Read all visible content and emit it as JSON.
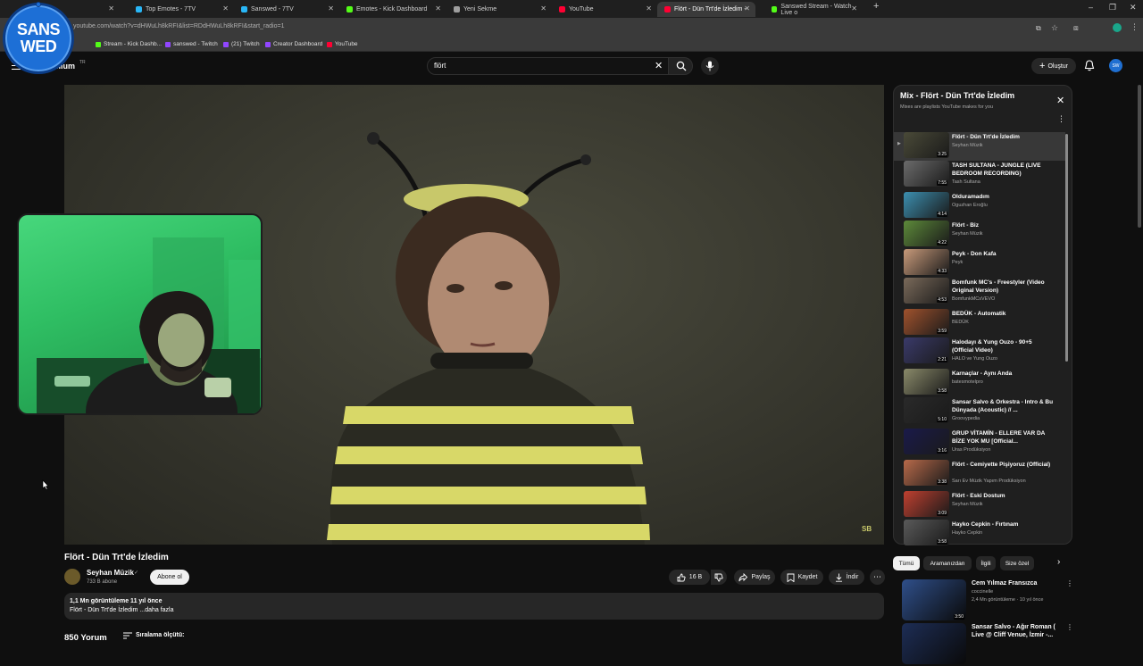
{
  "browser": {
    "tabs": [
      {
        "label": "",
        "favicon_color": "#8a8a8a"
      },
      {
        "label": "Top Emotes - 7TV",
        "favicon_color": "#29b6f6"
      },
      {
        "label": "Sanswed - 7TV",
        "favicon_color": "#29b6f6"
      },
      {
        "label": "Emotes - Kick Dashboard",
        "favicon_color": "#53fc18"
      },
      {
        "label": "Yeni Sekme",
        "favicon_color": "#9e9e9e"
      },
      {
        "label": "YouTube",
        "favicon_color": "#ff0033"
      },
      {
        "label": "Flört - Dün Trt'de İzledim -",
        "favicon_color": "#ff0033"
      },
      {
        "label": "Sanswed Stream - Watch Live o",
        "favicon_color": "#53fc18"
      }
    ],
    "url": "youtube.com/watch?v=dHWuLh8kRFI&list=RDdHWuLh8kRFI&start_radio=1",
    "bookmarks": [
      {
        "label": "Stream - Kick Dashb...",
        "favicon_color": "#53fc18"
      },
      {
        "label": "sanswed - Twitch",
        "favicon_color": "#9146ff"
      },
      {
        "label": "(21) Twitch",
        "favicon_color": "#9146ff"
      },
      {
        "label": "Creator Dashboard",
        "favicon_color": "#9146ff"
      },
      {
        "label": "YouTube",
        "favicon_color": "#ff0033"
      }
    ]
  },
  "overlay": {
    "logo_line1": "SANS",
    "logo_line2": "WED"
  },
  "header": {
    "brand": "mium",
    "brand_region": "TR",
    "search_value": "flört",
    "create_label": "Oluştur",
    "avatar_label": "SW"
  },
  "video": {
    "title": "Flört - Dün Trt'de İzledim",
    "watermark": "SB",
    "channel": {
      "name": "Seyhan Müzik",
      "subscribers": "733 B abone",
      "verified_icon": "✓"
    },
    "subscribe_label": "Abone ol",
    "likes": "16 B",
    "share_label": "Paylaş",
    "save_label": "Kaydet",
    "download_label": "İndir",
    "description": {
      "meta": "1,1 Mn görüntüleme  11 yıl önce",
      "text": "Flört - Dün Trt'de İzledim ...daha fazla"
    },
    "comments": {
      "count": "850 Yorum",
      "sort_label": "Sıralama ölçütü:"
    }
  },
  "playlist": {
    "title": "Mix - Flört - Dün Trt'de İzledim",
    "subtitle": "Mixes are playlists YouTube makes for you",
    "items": [
      {
        "title": "Flört - Dün Trt'de İzledim",
        "channel": "Seyhan Müzik",
        "duration": "3:25",
        "thumb": "#4a4a38"
      },
      {
        "title": "TASH SULTANA - JUNGLE (LIVE BEDROOM RECORDING)",
        "channel": "Tash Sultana",
        "duration": "7:55",
        "thumb": "#6b6b6b"
      },
      {
        "title": "Olduramadım",
        "channel": "Oguzhan Eroğlu",
        "duration": "4:14",
        "thumb": "#3c8fb0"
      },
      {
        "title": "Flört - Biz",
        "channel": "Seyhan Müzik",
        "duration": "4:22",
        "thumb": "#5d8a3a"
      },
      {
        "title": "Peyk - Don Kafa",
        "channel": "Peyk",
        "duration": "4:33",
        "thumb": "#c89a7a"
      },
      {
        "title": "Bomfunk MC's - Freestyler (Video Original Version)",
        "channel": "BomfunkMCsVEVO",
        "duration": "4:53",
        "thumb": "#7a6a5a"
      },
      {
        "title": "BEDÜK - Automatik",
        "channel": "BEDÜK",
        "duration": "3:59",
        "thumb": "#a0522d"
      },
      {
        "title": "Halodayı & Yung Ouzo - 90+5 (Official Video)",
        "channel": "HALO ve Yung Ouzo",
        "duration": "2:21",
        "thumb": "#3a3a6a"
      },
      {
        "title": "Karnaçlar - Aynı Anda",
        "channel": "batesmotelpro",
        "duration": "3:58",
        "thumb": "#8a8a6a"
      },
      {
        "title": "Sansar Salvo & Orkestra - Intro & Bu Dünyada (Acoustic) // ...",
        "channel": "Groovypedia",
        "duration": "5:10",
        "thumb": "#2a2a2a"
      },
      {
        "title": "GRUP VİTAMİN - ELLERE VAR DA BİZE YOK MU [Official...",
        "channel": "Uras Prodüksiyon",
        "duration": "3:16",
        "thumb": "#1a1a4a"
      },
      {
        "title": "Flört - Cemiyette Pişiyoruz (Official)",
        "channel": "Sarı Ev Müzik Yapım Prodüksiyon",
        "duration": "3:38",
        "thumb": "#b86a4a"
      },
      {
        "title": "Flört - Eski Dostum",
        "channel": "Seyhan Müzik",
        "duration": "3:09",
        "thumb": "#c04030"
      },
      {
        "title": "Hayko Cepkin - Fırtınam",
        "channel": "Hayko Cepkin",
        "duration": "3:58",
        "thumb": "#5a5a5a"
      }
    ]
  },
  "chips": [
    "Tümü",
    "Aramanızdan",
    "İlgili",
    "Size özel"
  ],
  "related": [
    {
      "title": "Cem Yılmaz Fransızca",
      "channel": "coccinelle",
      "meta": "2,4 Mn görüntüleme · 10 yıl önce",
      "duration": "3:50",
      "thumb": "#2f4f8a"
    },
    {
      "title": "Sansar Salvo - Ağır Roman ( Live @ Cliff Venue, İzmir -...",
      "channel": "",
      "meta": "",
      "duration": "",
      "thumb": "#1d2d55"
    }
  ],
  "icons": [
    "menu-icon",
    "search-icon",
    "close-icon",
    "mic-icon",
    "plus-icon",
    "bell-icon",
    "like-icon",
    "dislike-icon",
    "share-icon",
    "save-icon",
    "download-icon",
    "more-icon",
    "sort-icon",
    "chevron-right-icon",
    "play-icon"
  ]
}
